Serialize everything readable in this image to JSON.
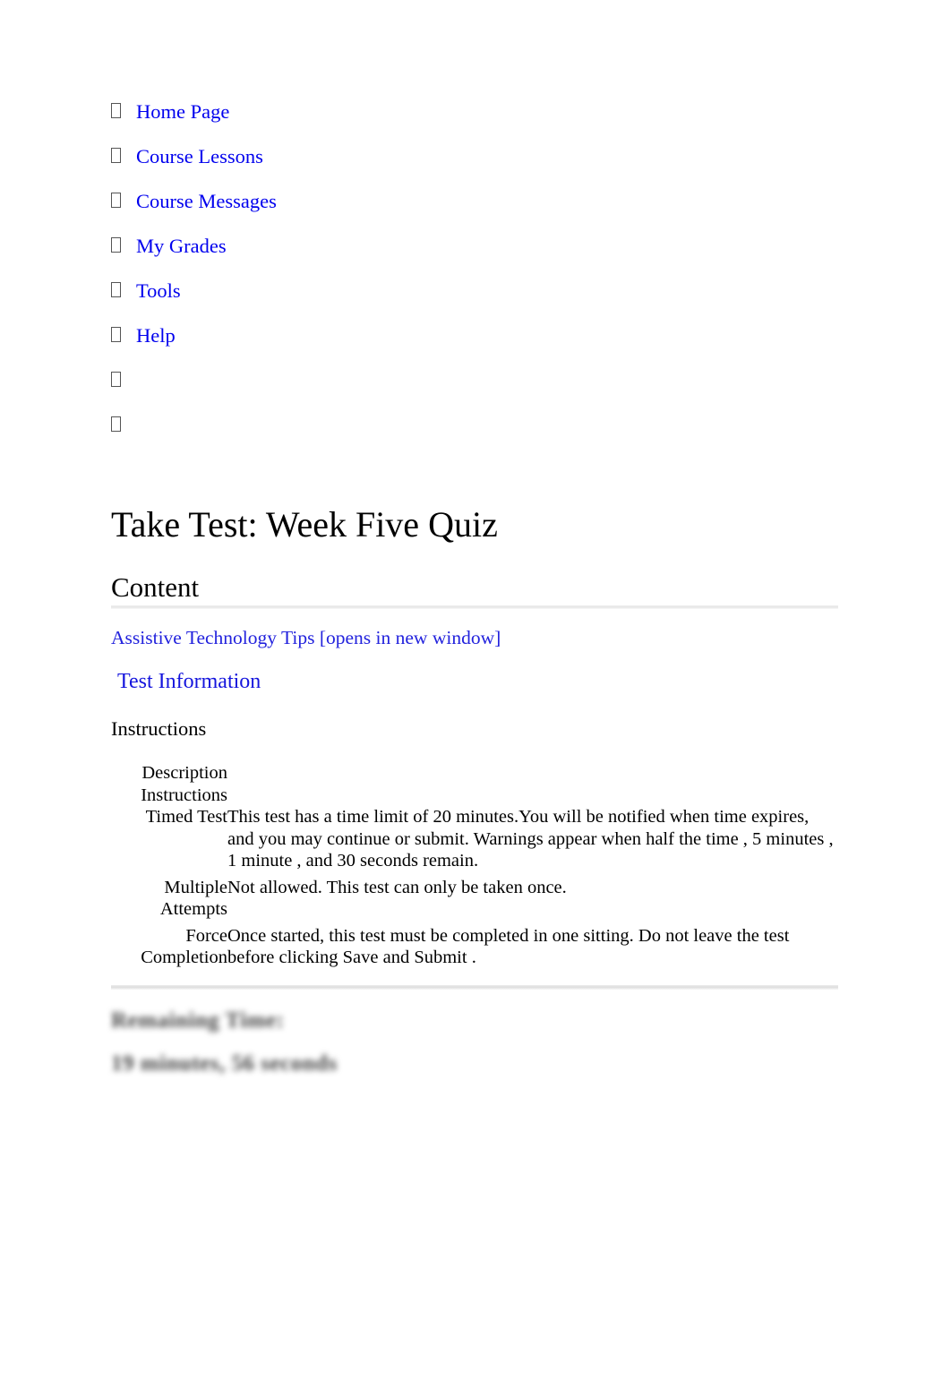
{
  "nav": {
    "bullet_icon": "tofu-box-glyph",
    "items": [
      {
        "label": "Home Page"
      },
      {
        "label": "Course Lessons"
      },
      {
        "label": "Course Messages"
      },
      {
        "label": "My Grades"
      },
      {
        "label": "Tools"
      },
      {
        "label": "Help"
      },
      {
        "label": ""
      },
      {
        "label": ""
      }
    ]
  },
  "page": {
    "title": "Take Test: Week Five Quiz",
    "content_heading": "Content",
    "assistive_link": "Assistive Technology Tips [opens in new window]",
    "test_information_link": "Test Information",
    "instructions_heading": "Instructions"
  },
  "instructions_table": {
    "rows": [
      {
        "label": "Description",
        "value": ""
      },
      {
        "label": "Instructions",
        "value": ""
      },
      {
        "label": "Timed Test",
        "value": "This test has a time limit of 20 minutes.You will be notified when time expires, and you may continue or submit.\nWarnings appear when half the time , 5 minutes , 1 minute , and 30 seconds remain."
      },
      {
        "label": "Multiple Attempts",
        "value": "Not allowed. This test can only be taken once."
      },
      {
        "label": "Force Completion",
        "value": "Once started, this test must be completed in one sitting. Do not leave the test before clicking Save and Submit ."
      }
    ]
  },
  "timer": {
    "remaining_label": "Remaining Time:",
    "remaining_value": "19 minutes, 56 seconds"
  },
  "colors": {
    "link": "#0000EE",
    "text": "#000000",
    "rule": "#e6e6e6",
    "background": "#ffffff"
  }
}
